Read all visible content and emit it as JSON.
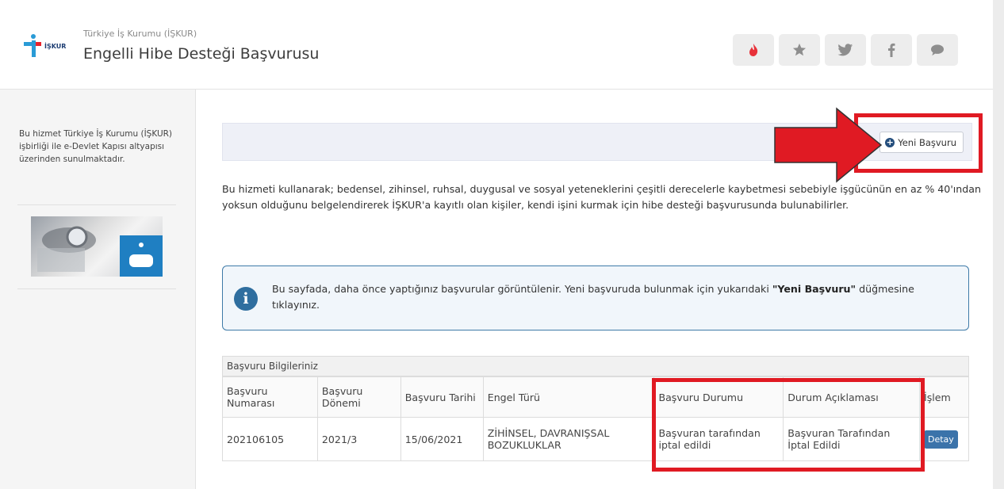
{
  "header": {
    "org_name": "Türkiye İş Kurumu (İŞKUR)",
    "service_title": "Engelli Hibe Desteği Başvurusu",
    "logo_text": "İŞKUR",
    "actions": [
      "fire-icon",
      "star-icon",
      "twitter-icon",
      "facebook-icon",
      "chat-icon"
    ]
  },
  "sidebar": {
    "description": "Bu hizmet Türkiye İş Kurumu (İŞKUR) işbirliği ile e-Devlet Kapısı altyapısı üzerinden sunulmaktadır."
  },
  "toolbar": {
    "new_application_label": "Yeni Başvuru"
  },
  "intro": "Bu hizmeti kullanarak; bedensel, zihinsel, ruhsal, duygusal ve sosyal yeteneklerini çeşitli derecelerle kaybetmesi sebebiyle işgücünün en az % 40'ından yoksun olduğunu belgelendirerek İŞKUR'a kayıtlı olan kişiler, kendi işini kurmak için hibe desteği başvurusunda bulunabilirler.",
  "info": {
    "text_before": "Bu sayfada, daha önce yaptığınız başvurular görüntülenir. Yeni başvuruda bulunmak için yukarıdaki ",
    "highlight": "\"Yeni Başvuru\"",
    "text_after": " düğmesine tıklayınız."
  },
  "table": {
    "caption": "Başvuru Bilgileriniz",
    "headers": [
      "Başvuru Numarası",
      "Başvuru Dönemi",
      "Başvuru Tarihi",
      "Engel Türü",
      "Başvuru Durumu",
      "Durum Açıklaması",
      "İşlem"
    ],
    "rows": [
      {
        "number": "202106105",
        "period": "2021/3",
        "date": "15/06/2021",
        "disability": "ZİHİNSEL, DAVRANIŞSAL BOZUKLUKLAR",
        "status": "Başvuran tarafından iptal edildi",
        "status_desc": "Başvuran Tarafından İptal Edildi",
        "action_label": "Detay"
      }
    ]
  },
  "colors": {
    "annotation_red": "#e01a23",
    "brand_blue": "#234d7c",
    "info_blue": "#2f6e9f"
  }
}
